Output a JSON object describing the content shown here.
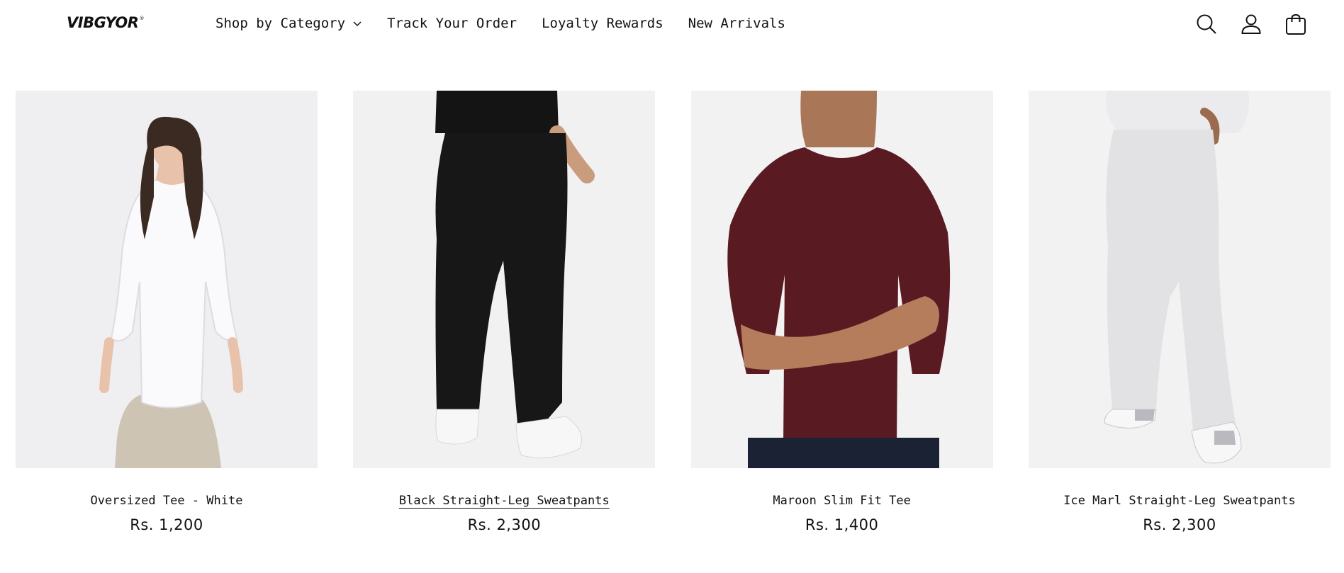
{
  "brand": {
    "logo_text": "VIBGYOR",
    "logo_mark": "®"
  },
  "nav": {
    "items": [
      {
        "label": "Shop by Category",
        "has_dropdown": true
      },
      {
        "label": "Track Your Order"
      },
      {
        "label": "Loyalty Rewards"
      },
      {
        "label": "New Arrivals"
      }
    ]
  },
  "header_icons": [
    "search-icon",
    "account-icon",
    "cart-icon"
  ],
  "products": [
    {
      "title": "Oversized Tee - White",
      "price": "Rs. 1,200",
      "image": "woman in white oversized tee",
      "hovered": false
    },
    {
      "title": "Black Straight-Leg Sweatpants",
      "price": "Rs. 2,300",
      "image": "black sweatpants back view",
      "hovered": true
    },
    {
      "title": "Maroon Slim Fit Tee",
      "price": "Rs. 1,400",
      "image": "man in maroon tee arms crossed",
      "hovered": false
    },
    {
      "title": "Ice Marl Straight-Leg Sweatpants",
      "price": "Rs. 2,300",
      "image": "light grey sweatpants",
      "hovered": false
    }
  ],
  "colors": {
    "text": "#121212",
    "background": "#ffffff",
    "image_bg": "#f2f2f3",
    "maroon": "#5a1a22"
  }
}
